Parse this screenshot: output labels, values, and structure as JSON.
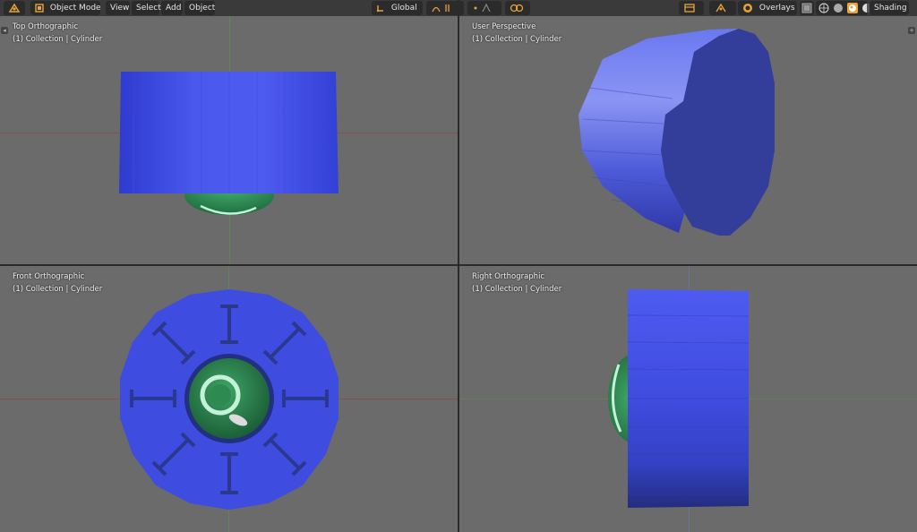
{
  "header": {
    "mode": "Object Mode",
    "menus": [
      "View",
      "Select",
      "Add",
      "Object"
    ],
    "orientation": "Global",
    "overlays": "Overlays",
    "shading": "Shading"
  },
  "viewports": {
    "top_left": {
      "title": "Top Orthographic",
      "subtitle": "(1) Collection | Cylinder"
    },
    "top_right": {
      "title": "User Perspective",
      "subtitle": "(1) Collection | Cylinder"
    },
    "bottom_left": {
      "title": "Front Orthographic",
      "subtitle": "(1) Collection | Cylinder"
    },
    "bottom_right": {
      "title": "Right Orthographic",
      "subtitle": "(1) Collection | Cylinder"
    }
  },
  "colors": {
    "viewport_bg": "#6b6b6b",
    "x_axis": "#8a4b4b",
    "y_axis": "#5e8a4b",
    "cylinder_blue": "#3e4de0",
    "sphere_green": "#2f8a52",
    "accent_orange": "#e8a33a"
  },
  "icons": {
    "editor_type": "editor-type-icon",
    "object_mode": "object-mode-icon",
    "transform_pivot": "pivot-icon",
    "snap": "magnet-icon",
    "proportional": "proportional-icon",
    "gizmo": "gizmo-icon",
    "show_hide": "visibility-icon",
    "overlays": "overlays-icon",
    "xray": "xray-icon",
    "shading_wire": "wireframe-icon",
    "shading_solid": "solid-icon",
    "shading_material": "material-icon",
    "shading_rendered": "rendered-icon"
  }
}
